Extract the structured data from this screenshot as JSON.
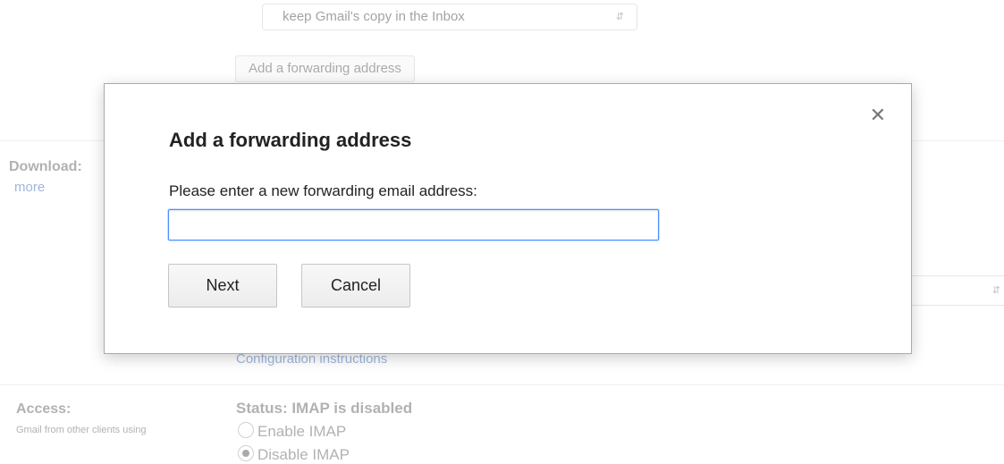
{
  "background": {
    "forward_select_value": "keep Gmail's copy in the Inbox",
    "add_forwarding_button": "Add a forwarding address",
    "download_label": "Download:",
    "learn_more_link": "more",
    "config_instructions_link": "Configuration instructions",
    "access_label": "Access:",
    "access_sublabel": "Gmail from other clients using",
    "imap_status": "Status: IMAP is disabled",
    "enable_imap_label": "Enable IMAP",
    "disable_imap_label": "Disable IMAP"
  },
  "dialog": {
    "title": "Add a forwarding address",
    "prompt": "Please enter a new forwarding email address:",
    "email_value": "",
    "next_label": "Next",
    "cancel_label": "Cancel",
    "close_icon": "close-icon"
  },
  "colors": {
    "link": "#2a5db0",
    "input_focus": "#4d90fe"
  }
}
